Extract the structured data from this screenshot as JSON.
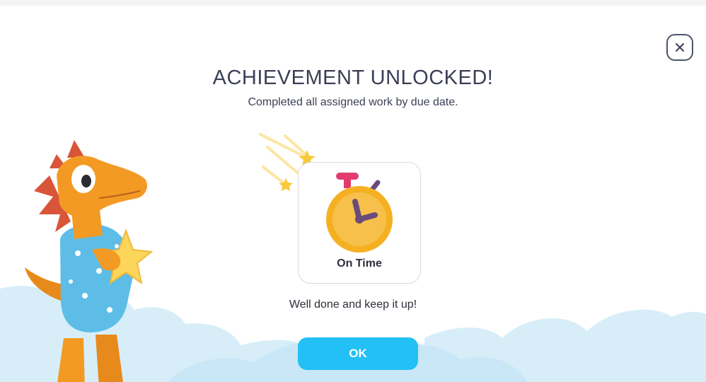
{
  "modal": {
    "title": "ACHIEVEMENT UNLOCKED!",
    "subtitle": "Completed all assigned work by due date.",
    "badge": {
      "label": "On Time",
      "icon": "stopwatch-icon"
    },
    "message": "Well done and keep it up!",
    "ok_label": "OK",
    "close_icon": "close-icon"
  },
  "colors": {
    "button": "#22c0f5",
    "clouds": "#cfeaf7",
    "stopwatch": "#f5b021",
    "text": "#3b3f55"
  }
}
